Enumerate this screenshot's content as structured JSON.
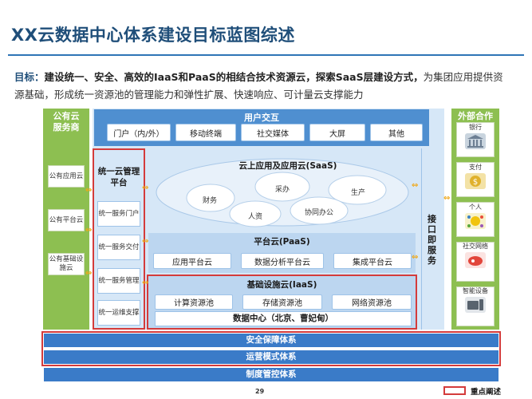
{
  "page": {
    "title": "XX云数据中心体系建设目标蓝图综述",
    "page_number": "29",
    "legend_label": "重点阐述"
  },
  "goal": {
    "label": "目标：",
    "bold_text": "建设统一、安全、高效的IaaS和PaaS的相结合技术资源云，探索SaaS层建设方式，",
    "normal_text_1": "为集团应用提供资",
    "normal_text_2": "源基础，形成统一资源池的管理能力和弹性扩展、快速响应、可计量云支撑能力"
  },
  "left_col": {
    "title_1": "公有云",
    "title_2": "服务商",
    "items": [
      "公有应用云",
      "公有平台云",
      "公有基础设施云"
    ]
  },
  "right_col": {
    "title": "外部合作",
    "items": [
      "银行",
      "支付",
      "个人",
      "社交网络",
      "智能设备"
    ]
  },
  "user_interaction": {
    "title": "用户交互",
    "items": [
      "门户（内/外）",
      "移动终端",
      "社交媒体",
      "大屏",
      "其他"
    ]
  },
  "unified_mgmt": {
    "title": "统一云管理平台",
    "items": [
      "统一服务门户",
      "统一服务交付",
      "统一服务管理",
      "统一运维支撑"
    ]
  },
  "saas": {
    "title": "云上应用及应用云(SaaS)",
    "words": [
      "财务",
      "采办",
      "生产",
      "人资",
      "协同办公"
    ]
  },
  "paas": {
    "title": "平台云(PaaS)",
    "items": [
      "应用平台云",
      "数据分析平台云",
      "集成平台云"
    ]
  },
  "iaas": {
    "title": "基础设施云(IaaS)",
    "items": [
      "计算资源池",
      "存储资源池",
      "网络资源池"
    ],
    "datacenter": "数据中心（北京、曹妃甸）"
  },
  "interface": {
    "chars": [
      "接",
      "口",
      "即",
      "服",
      "务"
    ]
  },
  "bottom": {
    "items": [
      "安全保障体系",
      "运营模式体系",
      "制度管控体系"
    ]
  }
}
